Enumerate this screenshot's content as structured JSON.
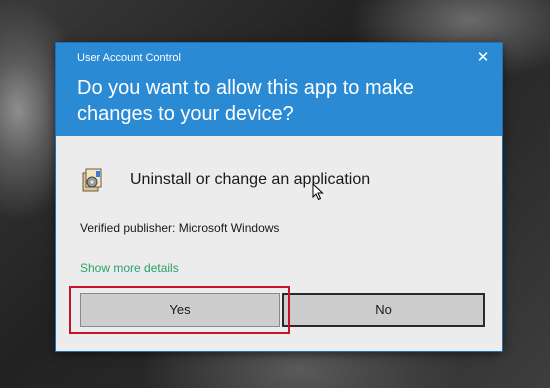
{
  "dialog": {
    "window_title": "User Account Control",
    "question": "Do you want to allow this app to make changes to your device?",
    "close_glyph": "✕",
    "app": {
      "name": "Uninstall or change an application",
      "icon": "control-panel-programs-icon"
    },
    "publisher": "Verified publisher: Microsoft Windows",
    "details_link": "Show more details",
    "buttons": {
      "yes": "Yes",
      "no": "No"
    }
  },
  "colors": {
    "header": "#2b8ad4",
    "body": "#ececec",
    "link": "#2aa06c",
    "highlight": "#c8122b"
  }
}
